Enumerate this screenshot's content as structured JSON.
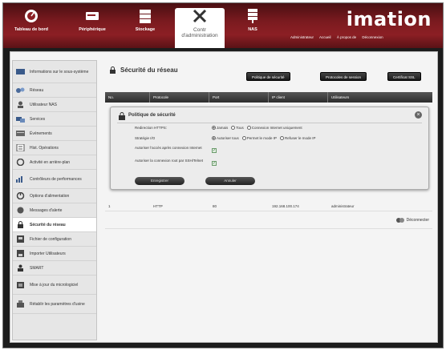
{
  "header": {
    "brand": "imation",
    "nav": [
      {
        "label": "Tableau de bord",
        "icon": "dashboard-icon"
      },
      {
        "label": "Périphérique",
        "icon": "device-icon"
      },
      {
        "label": "Stockage",
        "icon": "storage-icon"
      },
      {
        "label": "Contr d'administration",
        "icon": "admin-tools-icon"
      },
      {
        "label": "NAS",
        "icon": "nas-icon"
      }
    ],
    "links": {
      "home": "Accueil",
      "logout": "Déconnexion",
      "about": "À propos de",
      "user": "Administrateur"
    }
  },
  "sidebar": {
    "items": [
      {
        "label": "Informations sur le sous-système",
        "icon": "info-icon"
      },
      {
        "label": "Réseau",
        "icon": "network-icon"
      },
      {
        "label": "Utilisateur NAS",
        "icon": "user-icon"
      },
      {
        "label": "Services",
        "icon": "services-icon"
      },
      {
        "label": "Événements",
        "icon": "events-icon"
      },
      {
        "label": "Hist. Opérations",
        "icon": "history-icon"
      },
      {
        "label": "Activité en arrière-plan",
        "icon": "background-activity-icon"
      },
      {
        "label": "Contrôleurs de performances",
        "icon": "performance-icon"
      },
      {
        "label": "Options d'alimentation",
        "icon": "power-icon"
      },
      {
        "label": "Messages d'alerte",
        "icon": "alert-icon"
      },
      {
        "label": "Sécurité du réseau",
        "icon": "lock-icon"
      },
      {
        "label": "Fichier de configuration",
        "icon": "config-file-icon"
      },
      {
        "label": "Importer Utilisateurs",
        "icon": "import-users-icon"
      },
      {
        "label": "SMART",
        "icon": "smart-icon"
      },
      {
        "label": "Mise à jour du micrologiciel",
        "icon": "firmware-icon"
      },
      {
        "label": "Rétablir les paramètres d'usine",
        "icon": "factory-reset-icon"
      }
    ],
    "active_index": 10
  },
  "main": {
    "title": "Sécurité du réseau",
    "buttons": [
      "Politique de sécurité",
      "Protocoles de session",
      "Certificat SSL"
    ],
    "columns": [
      "No.",
      "Protocole",
      "Port",
      "IP client",
      "Utilisateurs"
    ],
    "row": {
      "no": "1",
      "protocol": "HTTP",
      "port": "80",
      "ip": "192.168.100.174",
      "user": "administrateur"
    },
    "disconnect": "Déconnecter"
  },
  "dialog": {
    "title": "Politique de sécurité",
    "fields": [
      {
        "label": "Redirection HTTPS:",
        "options": [
          "Jamais",
          "Tous",
          "Connexion Internet uniquement"
        ],
        "selected": 0
      },
      {
        "label": "Stratégie I/O",
        "options": [
          "Autoriser tous",
          "Permet le mode IP",
          "Refuser le mode IP"
        ],
        "selected": 0
      },
      {
        "label": "Autoriser l'accès après connexion Internet",
        "checked": true
      },
      {
        "label": "Autoriser la connexion root par SSH/Telnet",
        "checked": true
      }
    ],
    "save": "Enregistrer",
    "cancel": "Annuler"
  }
}
